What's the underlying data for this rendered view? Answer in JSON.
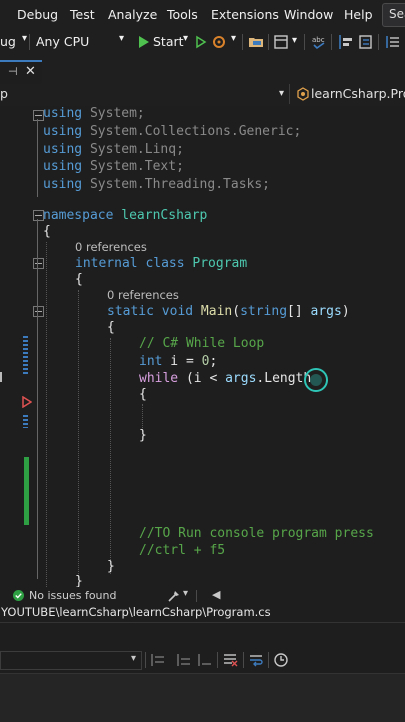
{
  "menu": {
    "items": [
      "Debug",
      "Test",
      "Analyze",
      "Tools",
      "Extensions",
      "Window",
      "Help"
    ],
    "search_label": "Sea"
  },
  "toolbar": {
    "config": "ug",
    "platform": "Any CPU",
    "start_label": "Start"
  },
  "navbar": {
    "left_text": "p",
    "right_text": "learnCsharp.Progr"
  },
  "code": {
    "using1_kw": "using",
    "using1_ns": "System;",
    "using2_kw": "using",
    "using2_a": "System.",
    "using2_b": "Collections.",
    "using2_c": "Generic;",
    "using3_kw": "using",
    "using3_a": "System.",
    "using3_b": "Linq;",
    "using4_kw": "using",
    "using4_a": "System.",
    "using4_b": "Text;",
    "using5_kw": "using",
    "using5_a": "System.",
    "using5_b": "Threading.",
    "using5_c": "Tasks;",
    "ns_kw": "namespace",
    "ns_name": "learnCsharp",
    "brace_open": "{",
    "refs1": "0 references",
    "class_mods": "internal class",
    "class_name": "Program",
    "refs2": "0 references",
    "main_mods": "static void",
    "main_name": "Main",
    "main_sig1": "(",
    "main_type": "string",
    "main_sig2": "[] ",
    "main_param": "args",
    "main_sig3": ")",
    "comment_while": "// C# While Loop",
    "int_kw": "int",
    "int_rest": " i = ",
    "int_val": "0",
    "int_end": ";",
    "while_kw": "while",
    "while_mid": " (i < ",
    "while_param": "args",
    "while_rest": ".Length",
    "brace_close": "}",
    "comment_run1": "//TO Run console program press",
    "comment_run2": "//ctrl + f5"
  },
  "status": {
    "issues": "No issues found"
  },
  "path": "YOUTUBE\\learnCsharp\\learnCsharp\\Program.cs",
  "colors": {
    "accent": "#3d7bbf",
    "success": "#2ea043",
    "breakpoint": "#e05252"
  }
}
